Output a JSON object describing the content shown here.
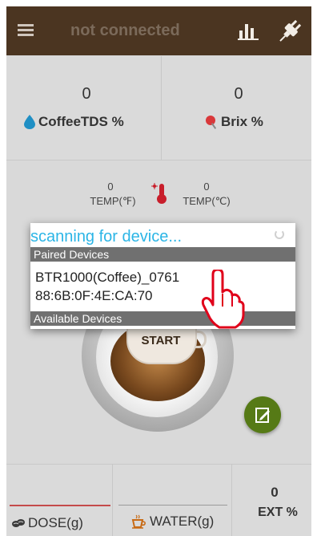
{
  "topbar": {
    "title": "not connected",
    "menu_icon": "menu-icon",
    "chart_icon": "bar-chart-icon",
    "plug_icon": "plug-icon"
  },
  "coffee_tds": {
    "value": "0",
    "label": "CoffeeTDS %",
    "icon": "water-drop-icon",
    "icon_color": "#1f8fc4"
  },
  "brix": {
    "value": "0",
    "label": "Brix %",
    "icon": "lollipop-icon",
    "icon_color": "#d9383a"
  },
  "temp_f": {
    "value": "0",
    "label": "TEMP(℉)"
  },
  "temp_c": {
    "value": "0",
    "label": "TEMP(℃)"
  },
  "thermometer_icon": "thermometer-icon",
  "start": {
    "label": "START"
  },
  "dialog": {
    "scanning_text": "scanning for device...",
    "paired_header": "Paired Devices",
    "device_name": "BTR1000(Coffee)_0761",
    "device_address": "88:6B:0F:4E:CA:70",
    "available_header": "Available Devices"
  },
  "bottom": {
    "dose_label": "DOSE(g)",
    "water_label": "WATER(g)",
    "ext_value": "0",
    "ext_label": "EXT %"
  },
  "colors": {
    "topbar": "#4b3521",
    "fab": "#567a16",
    "scanning": "#2bb5e6",
    "dose_underline": "#c44b4b"
  }
}
